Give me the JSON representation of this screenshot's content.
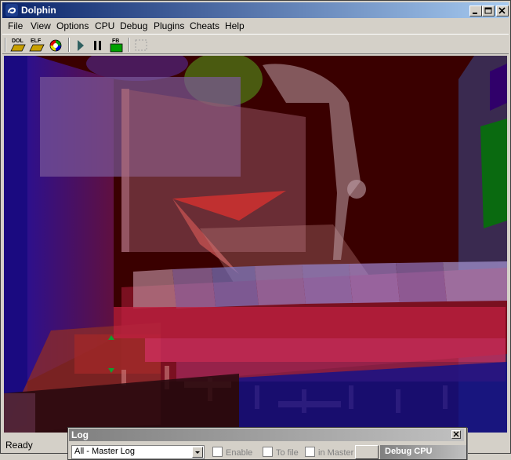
{
  "window": {
    "title": "Dolphin",
    "icon": "dolphin-logo-icon"
  },
  "menu": [
    "File",
    "View",
    "Options",
    "CPU",
    "Debug",
    "Plugins",
    "Cheats",
    "Help"
  ],
  "toolbar": {
    "dol_label": "DOL",
    "elf_label": "ELF",
    "fb_label": "FB"
  },
  "status": {
    "text": "Ready"
  },
  "log": {
    "title": "Log",
    "selected": "All - Master Log",
    "enable_label": "Enable",
    "tofile_label": "To file",
    "inmaster_label": "in Master",
    "panel_label": "Debug CPU"
  },
  "colors": {
    "title_active": "#0a246a",
    "title_inactive": "#808080",
    "chrome": "#d4d0c8"
  }
}
